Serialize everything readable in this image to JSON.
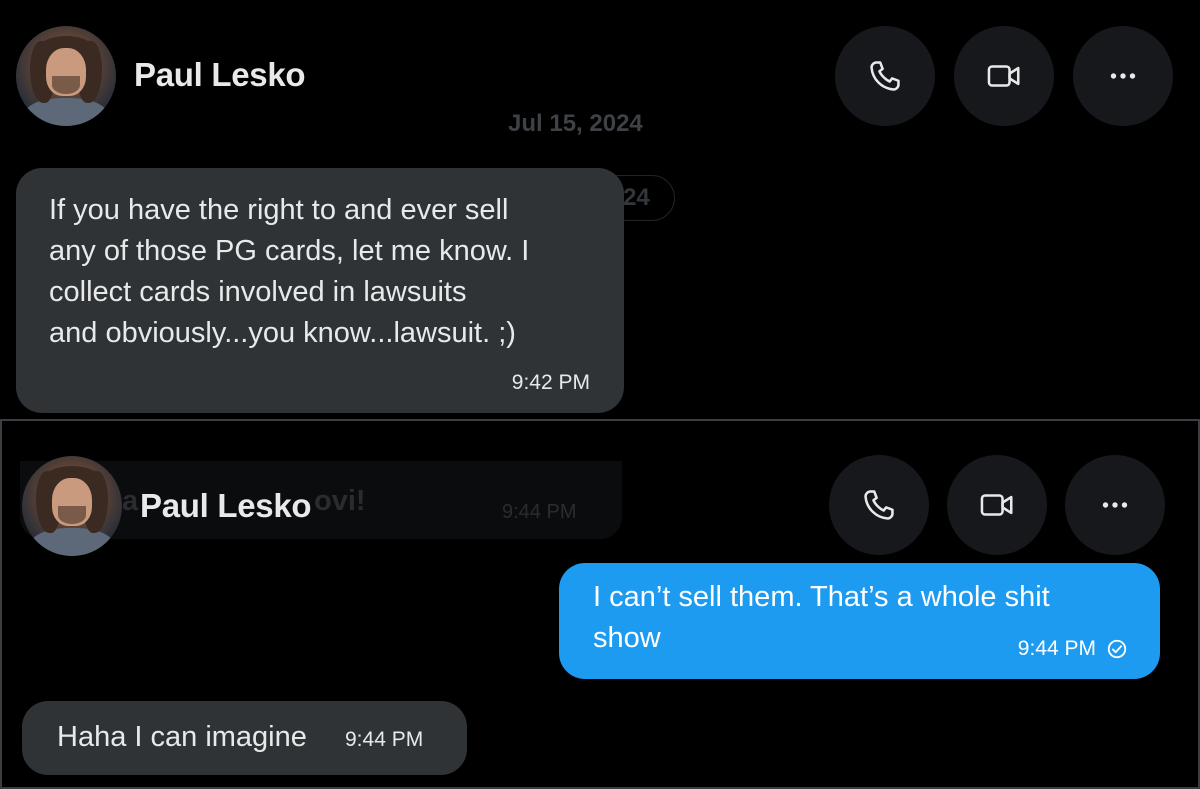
{
  "top": {
    "contact_name": "Paul Lesko",
    "date_ghost": "Jul 15, 2024",
    "date_pill": "Jul 15, 2024",
    "message": {
      "lines": [
        "If you have the right to and ever sell",
        "any of those PG cards, let me know. I",
        "collect cards involved in lawsuits",
        "and obviously...you know...lawsuit. ;)"
      ],
      "time": "9:42 PM"
    }
  },
  "bottom": {
    "contact_name": "Paul Lesko",
    "ghost_text_left": "a",
    "ghost_text_right": "ovi!",
    "ghost_time": "9:44 PM",
    "sent_message": {
      "lines": [
        "I can’t sell them. That’s a whole shit",
        "show"
      ],
      "time": "9:44 PM",
      "status_icon": "check-circle-icon"
    },
    "received_message": {
      "text": "Haha I can imagine",
      "time": "9:44 PM"
    }
  },
  "icons": {
    "call": "phone-icon",
    "video": "video-camera-icon",
    "more": "more-options-icon"
  },
  "colors": {
    "background": "#000000",
    "incoming_bubble": "#2f3336",
    "outgoing_bubble": "#1d9bf0",
    "action_button": "#16181c",
    "text_primary": "#e7e9ea"
  }
}
